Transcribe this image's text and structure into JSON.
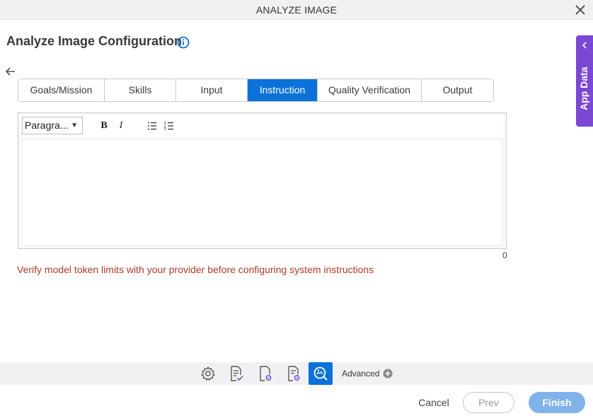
{
  "window": {
    "title": "ANALYZE IMAGE"
  },
  "page": {
    "title": "Analyze Image Configuration"
  },
  "tabs": [
    {
      "label": "Goals/Mission"
    },
    {
      "label": "Skills"
    },
    {
      "label": "Input"
    },
    {
      "label": "Instruction",
      "active": true
    },
    {
      "label": "Quality Verification"
    },
    {
      "label": "Output"
    }
  ],
  "editor": {
    "format_value": "Paragra...",
    "bold_label": "B",
    "italic_label": "I",
    "char_count": "0"
  },
  "warning": "Verify model token limits with your provider before configuring system instructions",
  "side_panel": {
    "label": "App Data"
  },
  "bottom_bar": {
    "advanced_label": "Advanced"
  },
  "footer": {
    "cancel_label": "Cancel",
    "prev_label": "Prev",
    "finish_label": "Finish"
  },
  "colors": {
    "accent": "#0a72d8",
    "side_panel": "#7a48d4",
    "warning": "#b03a2e",
    "finish": "#7fb3ea"
  }
}
